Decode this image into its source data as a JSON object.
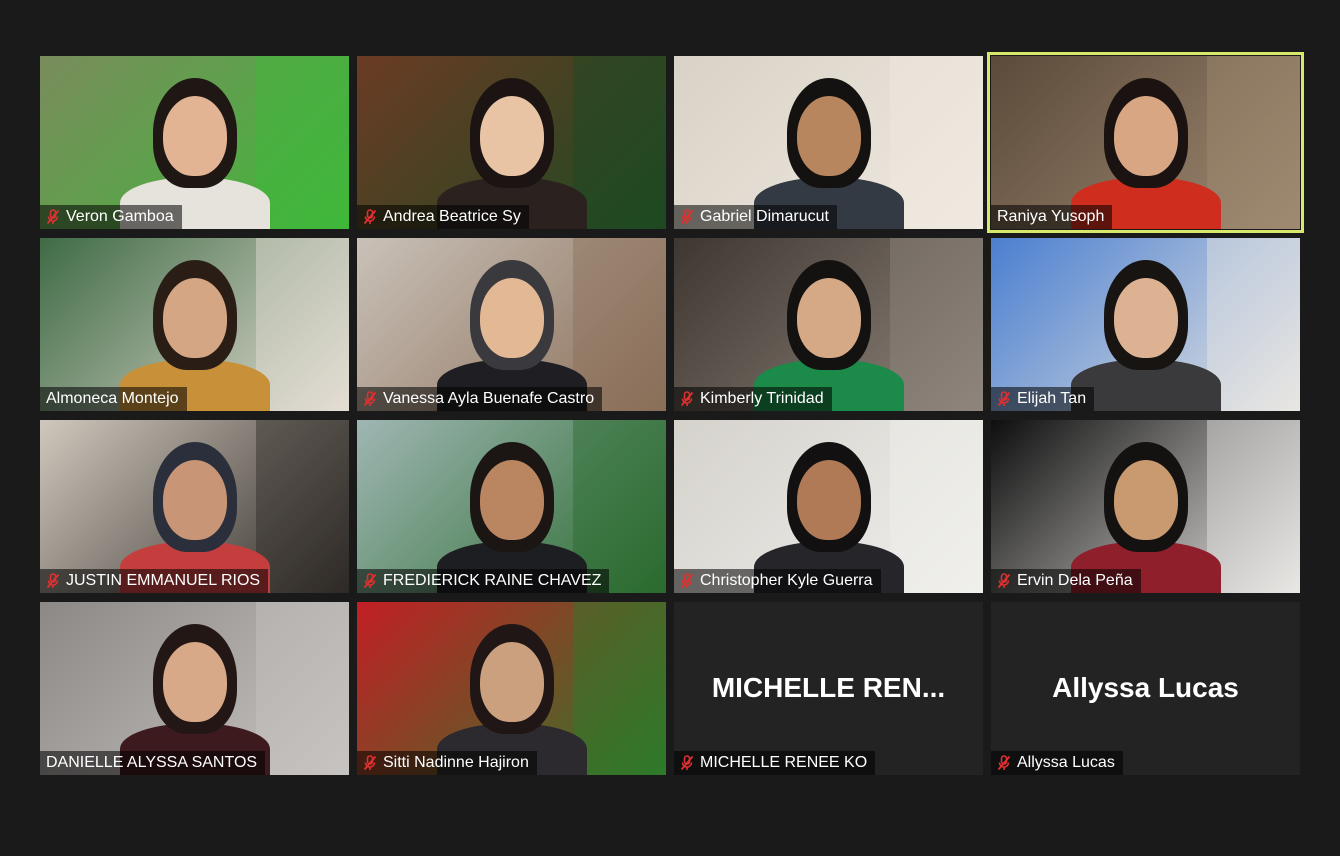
{
  "meeting": {
    "participants": [
      {
        "name": "Veron Gamboa",
        "muted": true,
        "bg": "#7a8c5c",
        "accent": "#3fb83a",
        "skin": "#e2b493",
        "hair": "#1e1714",
        "shirt": "#e6e2dc"
      },
      {
        "name": "Andrea Beatrice Sy",
        "muted": true,
        "bg": "#6b3b24",
        "accent": "#1d4a22",
        "skin": "#e8c4a4",
        "hair": "#1b1412",
        "shirt": "#2b2220"
      },
      {
        "name": "Gabriel Dimarucut",
        "muted": true,
        "bg": "#d9d2c6",
        "accent": "#efe9e1",
        "skin": "#b7865f",
        "hair": "#141210",
        "shirt": "#333a44"
      },
      {
        "name": "Raniya Yusoph",
        "muted": false,
        "active": true,
        "bg": "#5b4a3a",
        "accent": "#a08a72",
        "skin": "#d9a683",
        "hair": "#1a1311",
        "shirt": "#cf2d1e"
      },
      {
        "name": "Almoneca Montejo",
        "muted": false,
        "bg": "#3f6b45",
        "accent": "#e4ddd4",
        "skin": "#d5a684",
        "hair": "#2a1d15",
        "shirt": "#c89038"
      },
      {
        "name": "Vanessa Ayla Buenafe Castro",
        "muted": true,
        "bg": "#c9c1b8",
        "accent": "#8a6e58",
        "skin": "#e3b895",
        "hair": "#3a3a3e",
        "shirt": "#1f1f23"
      },
      {
        "name": "Kimberly Trinidad",
        "muted": true,
        "bg": "#3e3630",
        "accent": "#8f857c",
        "skin": "#d6a986",
        "hair": "#141111",
        "shirt": "#1c8a48"
      },
      {
        "name": "Elijah Tan",
        "muted": true,
        "bg": "#4b7fd0",
        "accent": "#e8e6e2",
        "skin": "#ddb293",
        "hair": "#171412",
        "shirt": "#3a3a3c"
      },
      {
        "name": "JUSTIN EMMANUEL RIOS",
        "muted": true,
        "bg": "#cfc8bd",
        "accent": "#2f2a26",
        "skin": "#c99577",
        "hair": "#2b2f3c",
        "shirt": "#c43e3e"
      },
      {
        "name": "FREDIERICK RAINE CHAVEZ",
        "muted": true,
        "bg": "#9fb6b3",
        "accent": "#2a6b2e",
        "skin": "#b98661",
        "hair": "#1b1613",
        "shirt": "#1d1e22"
      },
      {
        "name": "Christopher Kyle Guerra",
        "muted": true,
        "bg": "#d5d2cc",
        "accent": "#f0efec",
        "skin": "#b07a57",
        "hair": "#121010",
        "shirt": "#26262a"
      },
      {
        "name": "Ervin Dela Peña",
        "muted": true,
        "bg": "#0e0e0e",
        "accent": "#e9e7e4",
        "skin": "#c9996f",
        "hair": "#141111",
        "shirt": "#8e1f2b"
      },
      {
        "name": "DANIELLE ALYSSA SANTOS",
        "muted": false,
        "bg": "#8b8886",
        "accent": "#c7c4c1",
        "skin": "#d8a989",
        "hair": "#231715",
        "shirt": "#3c1a1e"
      },
      {
        "name": "Sitti Nadinne Hajiron",
        "muted": true,
        "bg": "#c21f24",
        "accent": "#2d7a2a",
        "skin": "#caa07f",
        "hair": "#1f1615",
        "shirt": "#2c2a2e"
      },
      {
        "name": "MICHELLE RENEE KO",
        "muted": true,
        "video_off": true,
        "display_label": "MICHELLE  REN..."
      },
      {
        "name": "Allyssa Lucas",
        "muted": true,
        "video_off": true,
        "display_label": "Allyssa Lucas"
      }
    ],
    "icons": {
      "muted": "microphone-muted-icon"
    },
    "colors": {
      "active_border": "#d8e86a",
      "mute_red": "#e0302f",
      "background": "#1a1a1a"
    }
  }
}
